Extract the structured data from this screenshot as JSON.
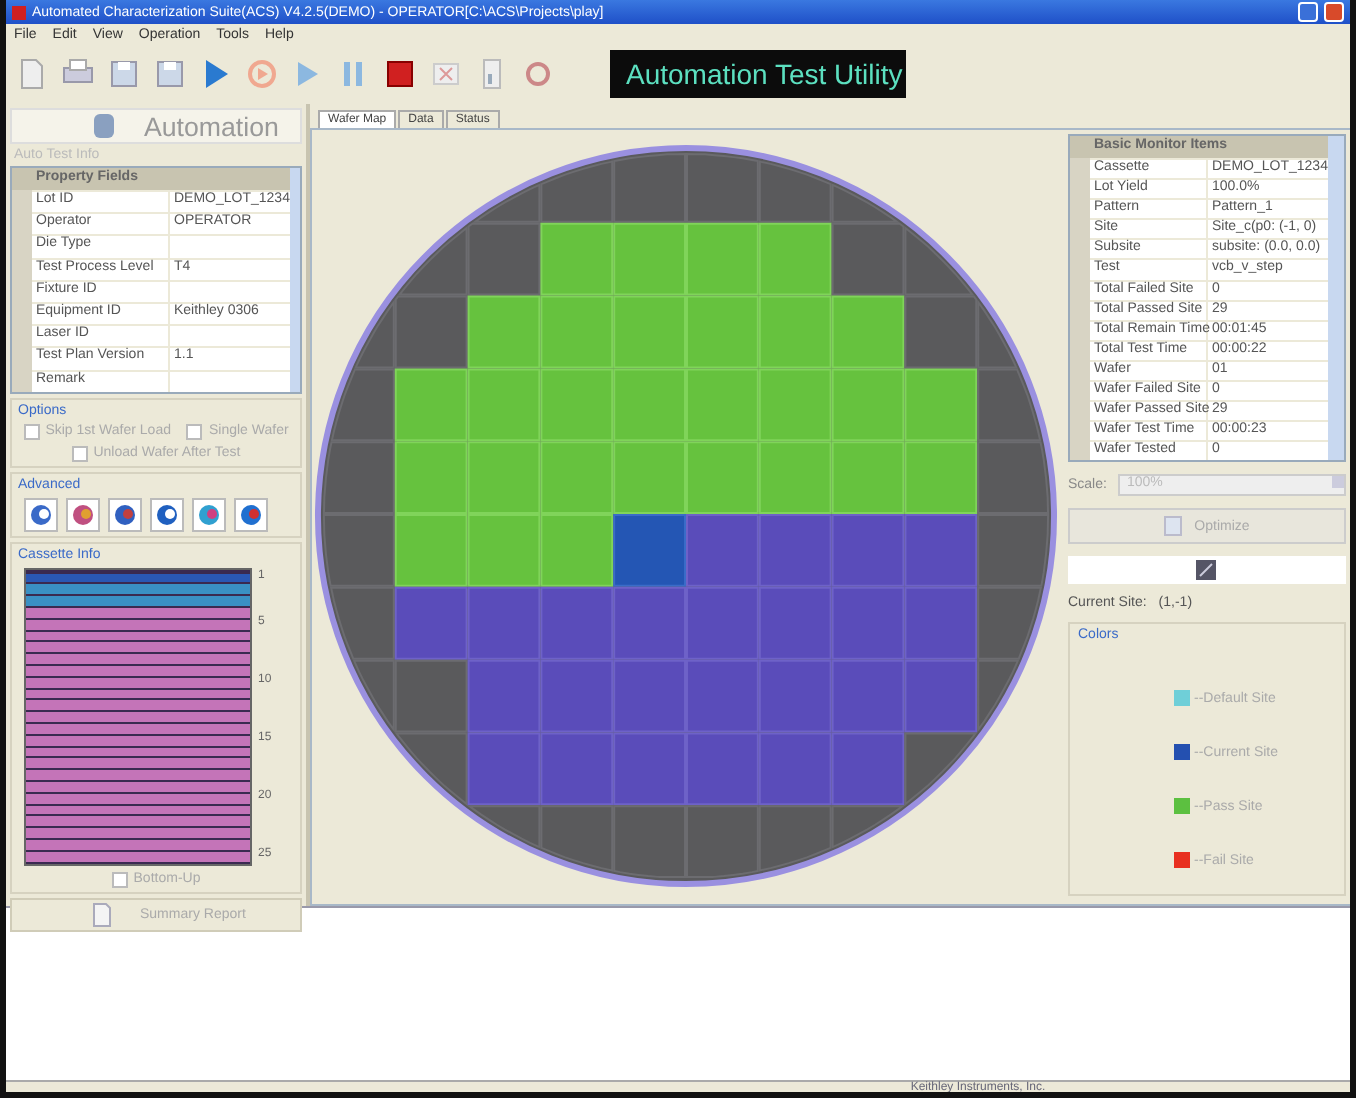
{
  "window": {
    "title": "Automated Characterization Suite(ACS) V4.2.5(DEMO) - OPERATOR[C:\\ACS\\Projects\\play]"
  },
  "menu": [
    "File",
    "Edit",
    "View",
    "Operation",
    "Tools",
    "Help"
  ],
  "banner": "Automation Test Utility",
  "left_panel": {
    "automation_button": "Automation",
    "info_label": "Auto Test Info",
    "property_grid": {
      "header": "Property Fields",
      "rows": [
        {
          "name": "Lot ID",
          "value": "DEMO_LOT_1234"
        },
        {
          "name": "Operator",
          "value": "OPERATOR"
        },
        {
          "name": "Die Type"
        },
        {
          "name": "Test Process Level",
          "value": "T4"
        },
        {
          "name": "Fixture ID"
        },
        {
          "name": "Equipment ID",
          "value": "Keithley 0306"
        },
        {
          "name": "Laser ID"
        },
        {
          "name": "Test Plan Version",
          "value": "1.1"
        },
        {
          "name": "Remark"
        }
      ]
    },
    "options": {
      "title": "Options",
      "checkboxes": [
        {
          "label": "Skip 1st Wafer Load",
          "checked": false
        },
        {
          "label": "Single Wafer",
          "checked": false
        },
        {
          "label": "Unload Wafer After Test",
          "checked": false
        }
      ]
    },
    "advanced": {
      "title": "Advanced"
    },
    "cassette": {
      "title": "Cassette Info",
      "slots": [
        {
          "kind": "current",
          "label": "1"
        },
        {
          "kind": "tested"
        },
        {
          "kind": "tested"
        },
        {
          "kind": "untested"
        },
        {
          "kind": "untested",
          "label": "5"
        },
        {
          "kind": "untested"
        },
        {
          "kind": "untested"
        },
        {
          "kind": "untested"
        },
        {
          "kind": "untested"
        },
        {
          "kind": "untested",
          "label": "10"
        },
        {
          "kind": "untested"
        },
        {
          "kind": "untested"
        },
        {
          "kind": "untested"
        },
        {
          "kind": "untested"
        },
        {
          "kind": "untested",
          "label": "15"
        },
        {
          "kind": "untested"
        },
        {
          "kind": "untested"
        },
        {
          "kind": "untested"
        },
        {
          "kind": "untested"
        },
        {
          "kind": "untested",
          "label": "20"
        },
        {
          "kind": "untested"
        },
        {
          "kind": "untested"
        },
        {
          "kind": "untested"
        },
        {
          "kind": "untested"
        },
        {
          "kind": "untested",
          "label": "25"
        }
      ],
      "bottom_up": {
        "label": "Bottom-Up",
        "checked": false
      }
    },
    "summary_button": "Summary Report"
  },
  "tabs": [
    {
      "label": "Wafer Map",
      "selected": true
    },
    {
      "label": "Data",
      "selected": false
    },
    {
      "label": "Status",
      "selected": false
    }
  ],
  "wafer_map": {
    "rows": [
      {
        "cells": [
          {
            "kind": "none"
          },
          {
            "kind": "none"
          },
          {
            "kind": "none"
          },
          {
            "kind": "none"
          },
          {
            "kind": "none"
          },
          {
            "kind": "none"
          },
          {
            "kind": "none"
          },
          {
            "kind": "none"
          },
          {
            "kind": "none"
          },
          {
            "kind": "none"
          }
        ]
      },
      {
        "cells": [
          {
            "kind": "none"
          },
          {
            "kind": "none"
          },
          {
            "kind": "none"
          },
          {
            "kind": "pass"
          },
          {
            "kind": "pass"
          },
          {
            "kind": "pass"
          },
          {
            "kind": "pass"
          },
          {
            "kind": "none"
          },
          {
            "kind": "none"
          },
          {
            "kind": "none"
          }
        ]
      },
      {
        "cells": [
          {
            "kind": "none"
          },
          {
            "kind": "none"
          },
          {
            "kind": "pass"
          },
          {
            "kind": "pass"
          },
          {
            "kind": "pass"
          },
          {
            "kind": "pass"
          },
          {
            "kind": "pass"
          },
          {
            "kind": "pass"
          },
          {
            "kind": "none"
          },
          {
            "kind": "none"
          }
        ]
      },
      {
        "cells": [
          {
            "kind": "none"
          },
          {
            "kind": "pass"
          },
          {
            "kind": "pass"
          },
          {
            "kind": "pass"
          },
          {
            "kind": "pass"
          },
          {
            "kind": "pass"
          },
          {
            "kind": "pass"
          },
          {
            "kind": "pass"
          },
          {
            "kind": "pass"
          },
          {
            "kind": "none"
          }
        ]
      },
      {
        "cells": [
          {
            "kind": "none"
          },
          {
            "kind": "pass"
          },
          {
            "kind": "pass"
          },
          {
            "kind": "pass"
          },
          {
            "kind": "pass"
          },
          {
            "kind": "pass"
          },
          {
            "kind": "pass"
          },
          {
            "kind": "pass"
          },
          {
            "kind": "pass"
          },
          {
            "kind": "none"
          }
        ]
      },
      {
        "cells": [
          {
            "kind": "none"
          },
          {
            "kind": "pass"
          },
          {
            "kind": "pass"
          },
          {
            "kind": "pass"
          },
          {
            "kind": "current"
          },
          {
            "kind": "untested"
          },
          {
            "kind": "untested"
          },
          {
            "kind": "untested"
          },
          {
            "kind": "untested"
          },
          {
            "kind": "none"
          }
        ]
      },
      {
        "cells": [
          {
            "kind": "none"
          },
          {
            "kind": "untested"
          },
          {
            "kind": "untested"
          },
          {
            "kind": "untested"
          },
          {
            "kind": "untested"
          },
          {
            "kind": "untested"
          },
          {
            "kind": "untested"
          },
          {
            "kind": "untested"
          },
          {
            "kind": "untested"
          },
          {
            "kind": "none"
          }
        ]
      },
      {
        "cells": [
          {
            "kind": "none"
          },
          {
            "kind": "none"
          },
          {
            "kind": "untested"
          },
          {
            "kind": "untested"
          },
          {
            "kind": "untested"
          },
          {
            "kind": "untested"
          },
          {
            "kind": "untested"
          },
          {
            "kind": "untested"
          },
          {
            "kind": "untested"
          },
          {
            "kind": "none"
          }
        ]
      },
      {
        "cells": [
          {
            "kind": "none"
          },
          {
            "kind": "none"
          },
          {
            "kind": "untested"
          },
          {
            "kind": "untested"
          },
          {
            "kind": "untested"
          },
          {
            "kind": "untested"
          },
          {
            "kind": "untested"
          },
          {
            "kind": "untested"
          },
          {
            "kind": "none"
          },
          {
            "kind": "none"
          }
        ]
      },
      {
        "cells": [
          {
            "kind": "none"
          },
          {
            "kind": "none"
          },
          {
            "kind": "none"
          },
          {
            "kind": "none"
          },
          {
            "kind": "none"
          },
          {
            "kind": "none"
          },
          {
            "kind": "none"
          },
          {
            "kind": "none"
          },
          {
            "kind": "none"
          },
          {
            "kind": "none"
          }
        ]
      }
    ]
  },
  "monitor": {
    "header": "Basic Monitor Items",
    "rows": [
      {
        "name": "Cassette",
        "value": "DEMO_LOT_1234"
      },
      {
        "name": "Lot Yield",
        "value": "100.0%"
      },
      {
        "name": "Pattern",
        "value": "Pattern_1"
      },
      {
        "name": "Site",
        "value": "Site_c(p0: (-1, 0)"
      },
      {
        "name": "Subsite",
        "value": "subsite: (0.0, 0.0)"
      },
      {
        "name": "Test",
        "value": "vcb_v_step"
      },
      {
        "name": "Total Failed Site",
        "value": "0"
      },
      {
        "name": "Total Passed Site",
        "value": "29"
      },
      {
        "name": "Total Remain Time",
        "value": "00:01:45"
      },
      {
        "name": "Total Test Time",
        "value": "00:00:22"
      },
      {
        "name": "Wafer",
        "value": "01"
      },
      {
        "name": "Wafer Failed Site",
        "value": "0"
      },
      {
        "name": "Wafer Passed Site",
        "value": "29"
      },
      {
        "name": "Wafer Test Time",
        "value": "00:00:23"
      },
      {
        "name": "Wafer Tested",
        "value": "0"
      }
    ]
  },
  "scale": {
    "label": "Scale:",
    "value": "100%"
  },
  "optimize_button": "Optimize",
  "current_site": {
    "label": "Current Site:",
    "value": "(1,-1)"
  },
  "colors": {
    "title": "Colors",
    "items": [
      {
        "label": "--Default Site",
        "color": "#6fcfd8"
      },
      {
        "label": "--Current Site",
        "color": "#2450b0"
      },
      {
        "label": "--Pass Site",
        "color": "#5cc040"
      },
      {
        "label": "--Fail Site",
        "color": "#e83020"
      }
    ]
  },
  "status_bar": "Keithley Instruments, Inc."
}
